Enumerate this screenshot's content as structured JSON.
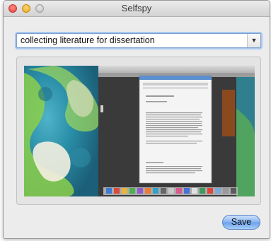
{
  "window": {
    "title": "Selfspy"
  },
  "activity": {
    "current_value": "collecting literature for dissertation"
  },
  "save_button": {
    "label": "Save"
  },
  "colors": {
    "accent_focus": "#a9c7ee",
    "button_blue": "#84b2f0"
  },
  "icons": {
    "close": "close-icon",
    "minimize": "minimize-icon",
    "zoom": "zoom-icon",
    "dropdown": "chevron-down-icon"
  }
}
